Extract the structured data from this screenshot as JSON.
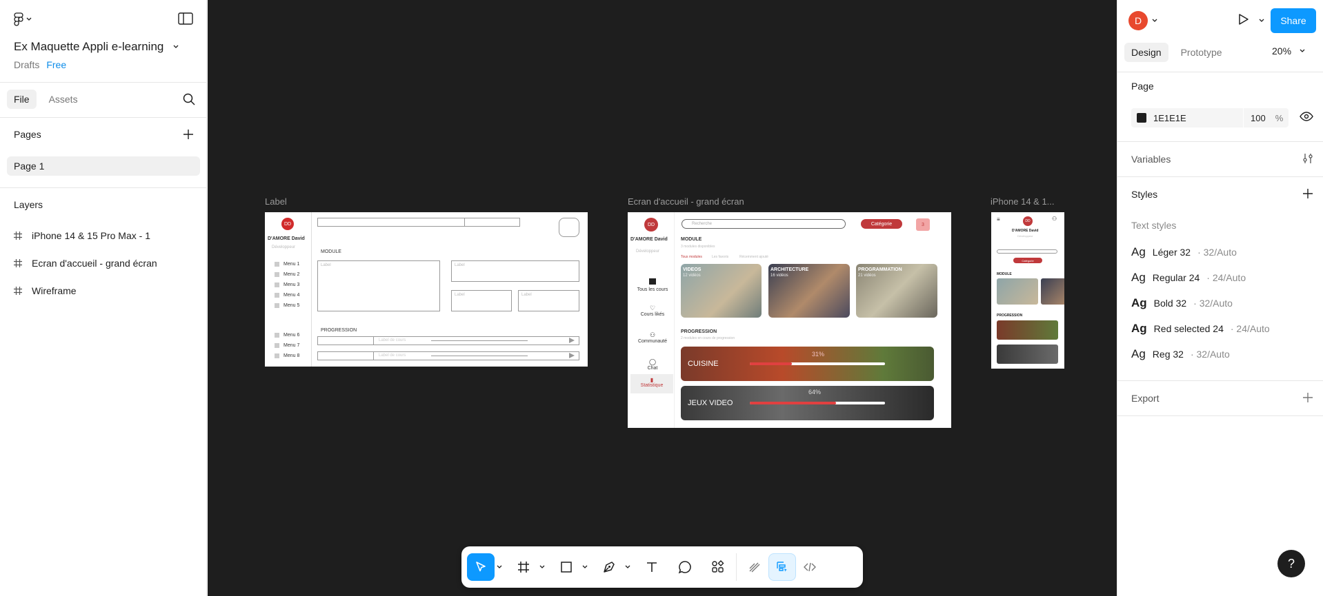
{
  "file": {
    "title": "Ex Maquette Appli e-learning",
    "location": "Drafts",
    "plan": "Free"
  },
  "left_tabs": [
    "File",
    "Assets"
  ],
  "pages": {
    "heading": "Pages",
    "items": [
      "Page 1"
    ]
  },
  "layers": {
    "heading": "Layers",
    "items": [
      "iPhone 14 & 15 Pro Max - 1",
      "Ecran d'accueil - grand écran",
      "Wireframe"
    ]
  },
  "frames": {
    "wireframe": {
      "label": "Label",
      "avatar": "DD",
      "name": "D'AMORE David",
      "role": "Développeur",
      "menus": [
        "Menu 1",
        "Menu 2",
        "Menu 3",
        "Menu 4",
        "Menu 5"
      ],
      "menus2": [
        "Menu 6",
        "Menu 7",
        "Menu 8"
      ],
      "module": "MODULE",
      "progression": "PROGRESSION",
      "course_label": "Label de cours"
    },
    "accueil": {
      "label": "Ecran d'accueil - grand écran",
      "avatar": "DD",
      "name": "D'AMORE David",
      "role": "Développeur",
      "search": "Recherche",
      "category": "Catégorie",
      "badge": "3",
      "module": "MODULE",
      "module_sub": "3 modules disponibles",
      "filters": [
        "Tous modules",
        "Les favoris",
        "Récemment ajouté"
      ],
      "nav": [
        "Tous les cours",
        "Cours likés",
        "Communauté",
        "Chat",
        "Statistique"
      ],
      "cards": [
        {
          "title": "VIDEOS",
          "sub": "12 vidéos"
        },
        {
          "title": "ARCHITECTURE",
          "sub": "16 vidéos"
        },
        {
          "title": "PROGRAMMATION",
          "sub": "21 vidéos"
        }
      ],
      "progression": "PROGRESSION",
      "progression_sub": "2 modules en cours de progression",
      "progress": [
        {
          "title": "CUISINE",
          "pct": "31%"
        },
        {
          "title": "JEUX VIDEO",
          "pct": "64%"
        }
      ]
    },
    "iphone": {
      "label": "iPhone 14 & 1...",
      "avatar": "DD",
      "name": "D'AMORE David",
      "role": "Développeur",
      "category": "Catégorie",
      "module": "MODULE",
      "progression": "PROGRESSION"
    }
  },
  "right": {
    "avatar": "D",
    "share": "Share",
    "tabs": [
      "Design",
      "Prototype"
    ],
    "zoom": "20%",
    "page_heading": "Page",
    "page_color": "1E1E1E",
    "page_opacity": "100",
    "opacity_unit": "%",
    "variables": "Variables",
    "styles": "Styles",
    "text_styles": "Text styles",
    "styles_list": [
      {
        "name": "Léger 32",
        "meta": "· 32/Auto"
      },
      {
        "name": "Regular 24",
        "meta": "· 24/Auto"
      },
      {
        "name": "Bold 32",
        "meta": "· 32/Auto"
      },
      {
        "name": "Red selected 24",
        "meta": "· 24/Auto"
      },
      {
        "name": "Reg 32",
        "meta": "· 32/Auto"
      }
    ],
    "ag": "Ag",
    "export": "Export",
    "help": "?"
  },
  "colors": {
    "canvas": "#1E1E1E",
    "accent": "#0D99FF",
    "red": "#D12B2B",
    "free": "#0D8CE9"
  }
}
